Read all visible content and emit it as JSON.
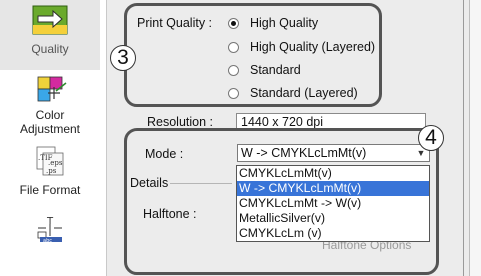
{
  "sidebar": {
    "items": [
      {
        "label": "Quality",
        "icon": "quality-arrow-icon"
      },
      {
        "label": "Color\nAdjustment",
        "icon": "color-adjustment-icon"
      },
      {
        "label": "File Format",
        "icon": "file-format-icon"
      },
      {
        "label": "",
        "icon": "text-layout-icon"
      }
    ]
  },
  "quality": {
    "label": "Print Quality :",
    "options": [
      "High Quality",
      "High Quality (Layered)",
      "Standard",
      "Standard (Layered)"
    ],
    "selected": "High Quality"
  },
  "resolution": {
    "label": "Resolution :",
    "value": "1440 x 720 dpi"
  },
  "mode": {
    "label": "Mode :",
    "selected": "W -> CMYKLcLmMt(v)",
    "options": [
      "CMYKLcLmMt(v)",
      "W -> CMYKLcLmMt(v)",
      "CMYKLcLmMt -> W(v)",
      "MetallicSilver(v)",
      "CMYKLcLm (v)"
    ],
    "highlighted": "W -> CMYKLcLmMt(v)"
  },
  "details": {
    "label": "Details"
  },
  "halftone": {
    "label": "Halftone :",
    "options_button": "Halftone Options"
  },
  "callouts": {
    "three": "3",
    "four": "4"
  }
}
